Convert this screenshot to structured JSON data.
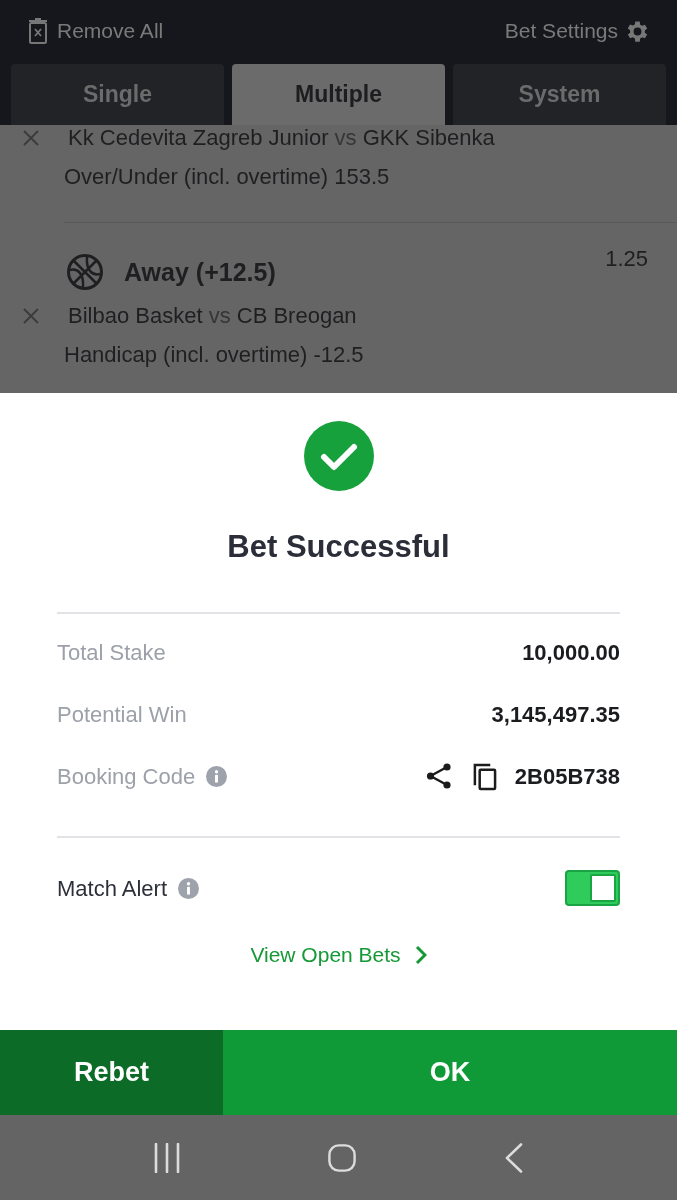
{
  "header": {
    "remove_all": "Remove All",
    "bet_settings": "Bet Settings"
  },
  "tabs": [
    {
      "label": "Single",
      "selected": false
    },
    {
      "label": "Multiple",
      "selected": true
    },
    {
      "label": "System",
      "selected": false
    }
  ],
  "bets": [
    {
      "teams": [
        "Kk Cedevita Zagreb Junior",
        "GKK Sibenka"
      ],
      "separator": "vs",
      "market": "Over/Under (incl. overtime) 153.5"
    },
    {
      "selection": "Away (+12.5)",
      "odds": "1.25",
      "teams": [
        "Bilbao Basket",
        "CB Breogan"
      ],
      "separator": "vs",
      "market": "Handicap (incl. overtime) -12.5"
    }
  ],
  "dialog": {
    "title": "Bet Successful",
    "rows": [
      {
        "kind": "amount",
        "label": "Total Stake",
        "value": "10,000.00",
        "info": false
      },
      {
        "kind": "amount",
        "label": "Potential Win",
        "value": "3,145,497.35",
        "info": false
      },
      {
        "kind": "code",
        "label": "Booking Code",
        "value": "2B05B738",
        "info": true
      }
    ],
    "match_alert": {
      "label": "Match Alert",
      "info": true,
      "on": true
    },
    "link": "View Open Bets"
  },
  "buttons": [
    {
      "kind": "secondary",
      "label": "Rebet"
    },
    {
      "kind": "primary",
      "label": "OK"
    }
  ]
}
